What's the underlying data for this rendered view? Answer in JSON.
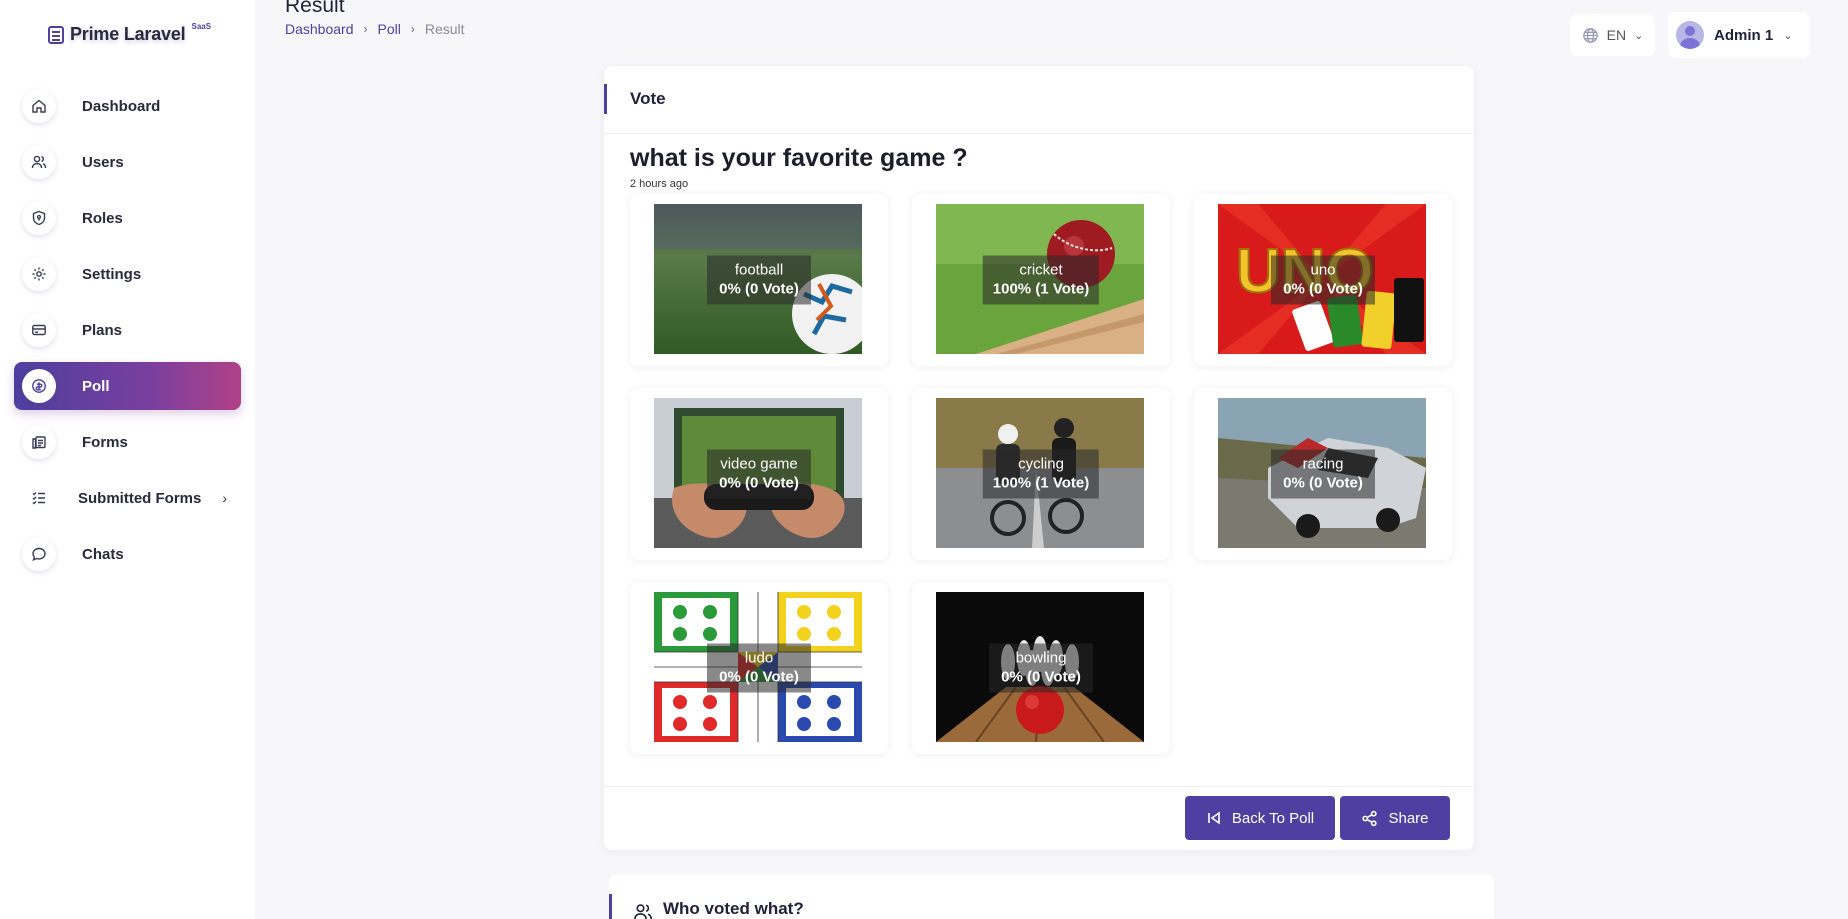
{
  "app": {
    "name": "Prime Laravel",
    "badge": "SaaS"
  },
  "sidebar": {
    "items": [
      {
        "label": "Dashboard",
        "icon": "home-icon"
      },
      {
        "label": "Users",
        "icon": "users-icon"
      },
      {
        "label": "Roles",
        "icon": "shield-icon"
      },
      {
        "label": "Settings",
        "icon": "gear-icon"
      },
      {
        "label": "Plans",
        "icon": "card-icon"
      },
      {
        "label": "Poll",
        "icon": "poll-icon",
        "active": true
      },
      {
        "label": "Forms",
        "icon": "forms-icon"
      },
      {
        "label": "Submitted Forms",
        "icon": "checklist-icon"
      },
      {
        "label": "Chats",
        "icon": "chat-icon"
      }
    ]
  },
  "header": {
    "title": "Result",
    "breadcrumb": [
      "Dashboard",
      "Poll",
      "Result"
    ],
    "language": "EN",
    "user": "Admin 1"
  },
  "vote": {
    "card_title": "Vote",
    "question": "what is your favorite game ?",
    "time": "2 hours ago",
    "options": [
      {
        "name": "football",
        "result": "0% (0 Vote)"
      },
      {
        "name": "cricket",
        "result": "100% (1 Vote)"
      },
      {
        "name": "uno",
        "result": "0% (0 Vote)"
      },
      {
        "name": "video game",
        "result": "0% (0 Vote)"
      },
      {
        "name": "cycling",
        "result": "100% (1 Vote)"
      },
      {
        "name": "racing",
        "result": "0% (0 Vote)"
      },
      {
        "name": "ludo",
        "result": "0% (0 Vote)"
      },
      {
        "name": "bowling",
        "result": "0% (0 Vote)"
      }
    ],
    "back_label": "Back To Poll",
    "share_label": "Share"
  },
  "who_voted": {
    "title": "Who voted what?"
  },
  "colors": {
    "primary": "#4f3fa0",
    "gradient_end": "#b04188"
  }
}
